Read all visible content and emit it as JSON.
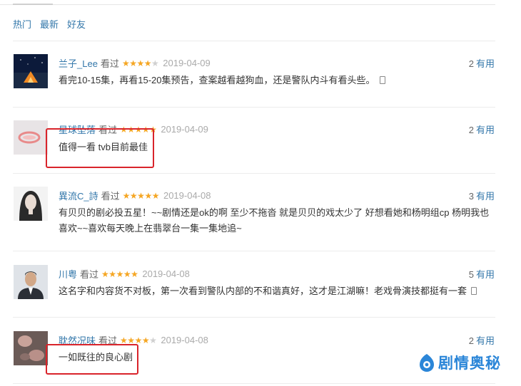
{
  "tabs": [
    {
      "label": "热门"
    },
    {
      "label": "最新"
    },
    {
      "label": "好友"
    }
  ],
  "watched_label": "看过",
  "useful_label": "有用",
  "reviews": [
    {
      "user": "兰子_Lee",
      "rating": 4,
      "date": "2019-04-09",
      "votes": "2",
      "content": "看完10-15集，再看15-20集预告，查案越看越狗血，还是警队内斗有看头些。",
      "mobile": true,
      "avatar": "night-tent"
    },
    {
      "user": "星球坠落",
      "rating": 5,
      "date": "2019-04-09",
      "votes": "2",
      "content": "值得一看 tvb目前最佳",
      "mobile": false,
      "avatar": "pink-ring"
    },
    {
      "user": "異流C_詩",
      "rating": 5,
      "date": "2019-04-08",
      "votes": "3",
      "content": "有贝贝的剧必投五星！~~剧情还是ok的啊 至少不拖沓 就是贝贝的戏太少了 好想看她和杨明组cp 杨明我也喜欢~~喜欢每天晚上在翡翠台一集一集地追~",
      "mobile": false,
      "avatar": "long-hair"
    },
    {
      "user": "川粤",
      "rating": 5,
      "date": "2019-04-08",
      "votes": "5",
      "content": "这名字和内容货不对板，第一次看到警队内部的不和谐真好，这才是江湖嘛！老戏骨演技都挺有一套",
      "mobile": true,
      "avatar": "man-suit"
    },
    {
      "user": "耽然况味",
      "rating": 4,
      "date": "2019-04-08",
      "votes": "2",
      "content": "一如既往的良心剧",
      "mobile": false,
      "avatar": "blurry-faces"
    }
  ],
  "watermark": {
    "text": "剧情奥秘",
    "color": "#2b86d8"
  },
  "colors": {
    "link": "#3377aa",
    "star": "#f5a623",
    "highlight": "#d9242b"
  }
}
